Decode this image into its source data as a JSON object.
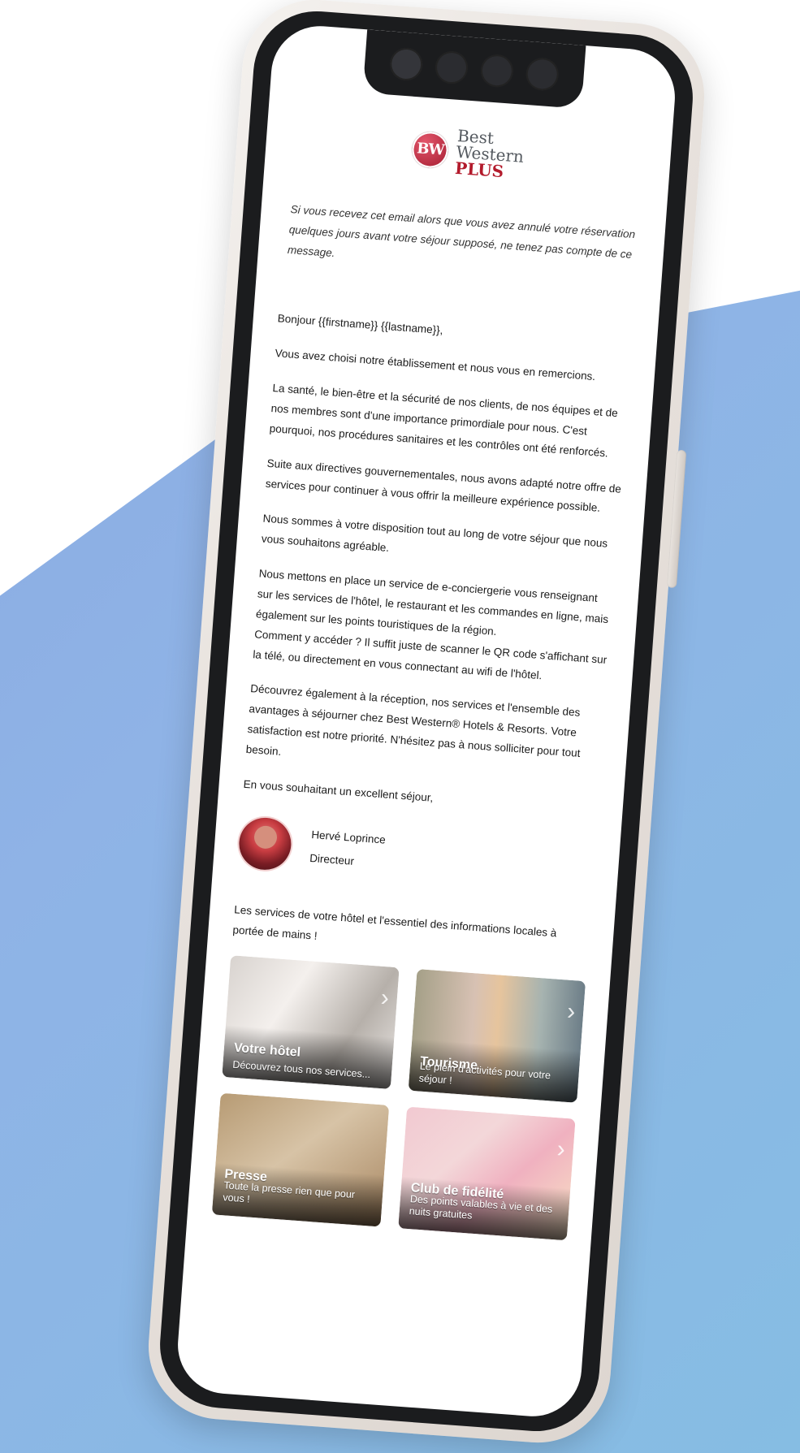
{
  "brand": {
    "badge_text": "BW",
    "line1": "Best",
    "line2": "Western",
    "line3": "PLUS",
    "badge_color": "#b31b2c"
  },
  "email": {
    "notice": "Si vous recevez cet email alors que vous avez annulé votre réservation quelques jours avant votre séjour supposé, ne tenez pas compte de ce message.",
    "greeting": "Bonjour {{firstname}} {{lastname}},",
    "p1": "Vous avez choisi notre établissement et nous vous en remercions.",
    "p2": "La santé, le bien-être et la sécurité de nos clients, de nos équipes et de nos membres sont d'une importance primordiale pour nous. C'est pourquoi, nos procédures sanitaires et les contrôles ont été renforcés.",
    "p3": "Suite aux directives gouvernementales, nous avons adapté notre offre de services pour continuer à vous offrir la meilleure expérience possible.",
    "p4": "Nous sommes à votre disposition tout au long de votre séjour que nous vous souhaitons agréable.",
    "p5a": "Nous mettons en place un service de e-conciergerie vous renseignant sur les services de l'hôtel, le restaurant et les commandes en ligne, mais également sur les points touristiques de la région.",
    "p5b": "Comment y accéder ? Il suffit juste de scanner le QR code s'affichant sur la télé, ou directement en vous connectant au wifi de l'hôtel.",
    "p6": "Découvrez également à la réception, nos services et l'ensemble des avantages à séjourner chez Best Western® Hotels & Resorts. Votre satisfaction est notre priorité. N'hésitez pas à nous solliciter pour tout besoin.",
    "closing": "En vous souhaitant un excellent séjour,",
    "signature_name": "Hervé Loprince",
    "signature_role": "Directeur",
    "services_intro": "Les services de votre hôtel et l'essentiel des informations locales à portée de mains !"
  },
  "cards": [
    {
      "title": "Votre hôtel",
      "subtitle": "Découvrez tous nos services..."
    },
    {
      "title": "Tourisme",
      "subtitle": "Le plein d'activités pour votre séjour !"
    },
    {
      "title": "Presse",
      "subtitle": "Toute la presse rien que pour vous !"
    },
    {
      "title": "Club de fidélité",
      "subtitle": "Des points valables à vie et des nuits gratuites"
    }
  ],
  "icons": {
    "chevron": "chevron-right-icon"
  }
}
